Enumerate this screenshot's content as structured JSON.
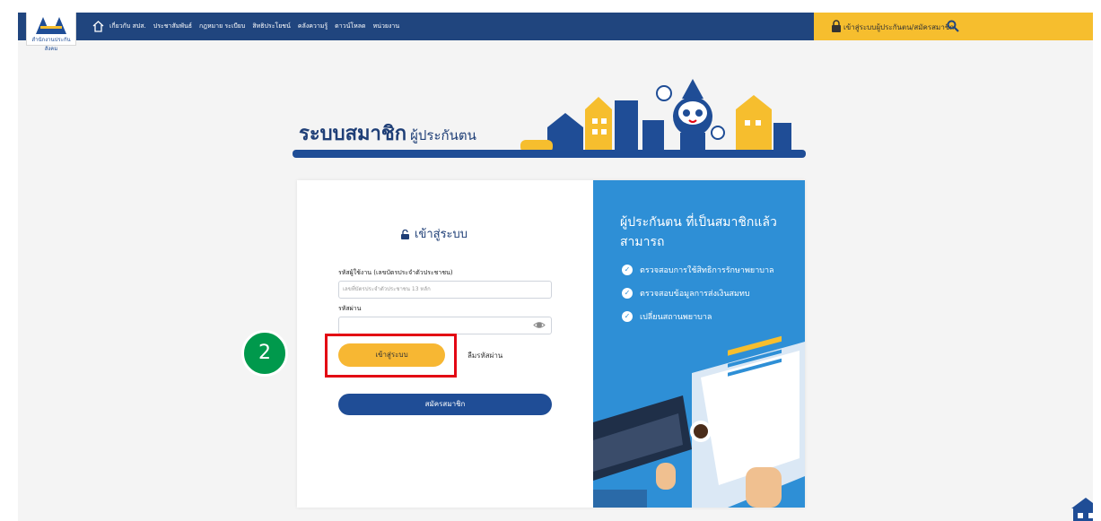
{
  "nav": {
    "logo_caption": "สำนักงานประกันสังคม",
    "menu": [
      "เกี่ยวกับ สปส.",
      "ประชาสัมพันธ์",
      "กฎหมาย ระเบียบ",
      "สิทธิประโยชน์",
      "คลังความรู้",
      "ดาวน์โหลด",
      "หน่วยงาน"
    ],
    "login_link": "เข้าสู่ระบบผู้ประกันตน/สมัครสมาชิก"
  },
  "banner": {
    "title": "ระบบสมาชิก",
    "subtitle": "ผู้ประกันตน"
  },
  "login": {
    "title": "เข้าสู่ระบบ",
    "username_label": "รหัสผู้ใช้งาน (เลขบัตรประจำตัวประชาชน)",
    "username_placeholder": "เลขที่บัตรประจำตัวประชาชน 13 หลัก",
    "password_label": "รหัสผ่าน",
    "login_button": "เข้าสู่ระบบ",
    "forgot_link": "ลืมรหัสผ่าน",
    "register_button": "สมัครสมาชิก"
  },
  "step_badge": "2",
  "benefits": {
    "title": "ผู้ประกันตน ที่เป็นสมาชิกแล้ว สามารถ",
    "items": [
      "ตรวจสอบการใช้สิทธิการรักษาพยาบาล",
      "ตรวจสอบข้อมูลการส่งเงินสมทบ",
      "เปลี่ยนสถานพยาบาล"
    ]
  },
  "colors": {
    "nav_blue": "#20457e",
    "accent_yellow": "#f6be2e",
    "panel_blue": "#2e8fd6",
    "highlight_red": "#e30613",
    "step_green": "#00994c"
  }
}
